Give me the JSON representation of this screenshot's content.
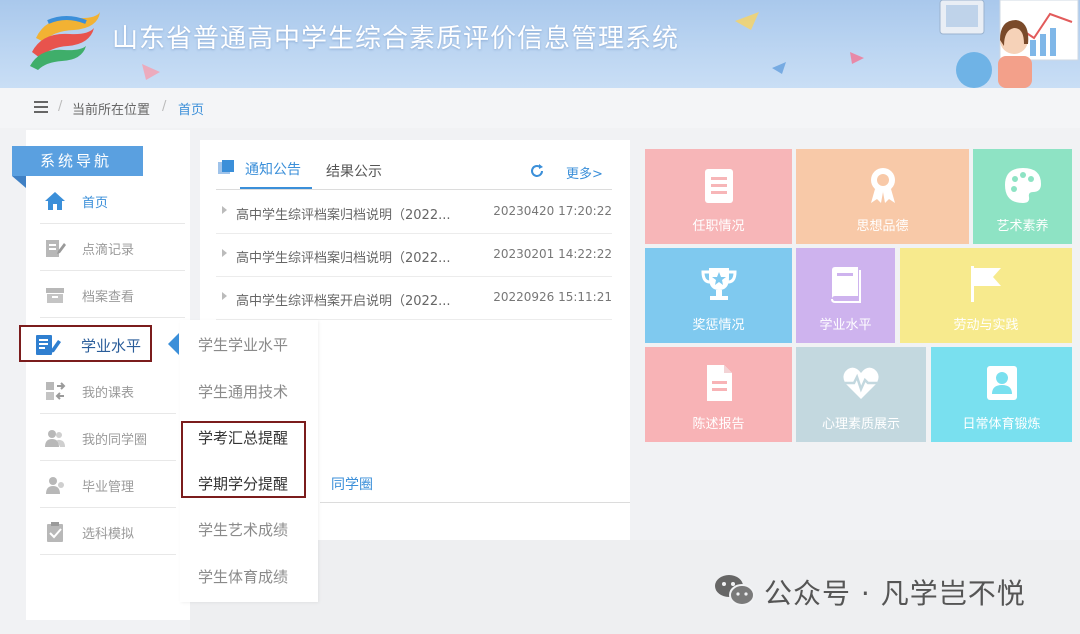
{
  "header": {
    "title": "山东省普通高中学生综合素质评价信息管理系统"
  },
  "breadcrumb": {
    "label": "当前所在位置",
    "separator": "/",
    "current": "首页"
  },
  "sidebar": {
    "heading": "系统导航",
    "items": [
      {
        "label": "首页",
        "icon": "home-icon"
      },
      {
        "label": "点滴记录",
        "icon": "edit-note-icon"
      },
      {
        "label": "档案查看",
        "icon": "archive-box-icon"
      },
      {
        "label": "学业水平",
        "icon": "study-edit-icon"
      },
      {
        "label": "我的课表",
        "icon": "schedule-icon"
      },
      {
        "label": "我的同学圈",
        "icon": "classmates-icon"
      },
      {
        "label": "毕业管理",
        "icon": "graduate-icon"
      },
      {
        "label": "选科模拟",
        "icon": "clipboard-check-icon"
      }
    ]
  },
  "submenu": {
    "items": [
      "学生学业水平",
      "学生通用技术",
      "学考汇总提醒",
      "学期学分提醒",
      "学生艺术成绩",
      "学生体育成绩"
    ]
  },
  "notices": {
    "tabs": [
      "通知公告",
      "结果公示"
    ],
    "more": "更多>",
    "rows": [
      {
        "title": "高中学生综评档案归档说明（2022...",
        "date": "20230420 17:20:22"
      },
      {
        "title": "高中学生综评档案归档说明（2022...",
        "date": "20230201 14:22:22"
      },
      {
        "title": "高中学生综评档案开启说明（2022...",
        "date": "20220926 15:11:21"
      }
    ],
    "lower_tab": "同学圈"
  },
  "tiles": [
    {
      "label": "任职情况",
      "color": "#f7b6b8",
      "icon": "document-list-icon"
    },
    {
      "label": "思想品德",
      "color": "#f8c9a8",
      "icon": "award-ribbon-icon"
    },
    {
      "label": "艺术素养",
      "color": "#8ee3c4",
      "icon": "palette-icon"
    },
    {
      "label": "奖惩情况",
      "color": "#7fc9ef",
      "icon": "trophy-icon"
    },
    {
      "label": "学业水平",
      "color": "#ceb3ee",
      "icon": "book-icon"
    },
    {
      "label": "劳动与实践",
      "color": "#f7ea8d",
      "icon": "flag-icon"
    },
    {
      "label": "陈述报告",
      "color": "#f8b3b6",
      "icon": "report-file-icon"
    },
    {
      "label": "心理素质展示",
      "color": "#c3d8df",
      "icon": "heartbeat-icon"
    },
    {
      "label": "日常体育锻炼",
      "color": "#79e0ef",
      "icon": "id-card-icon"
    }
  ],
  "watermark": {
    "text": "公众号 · 凡学岂不悦"
  }
}
